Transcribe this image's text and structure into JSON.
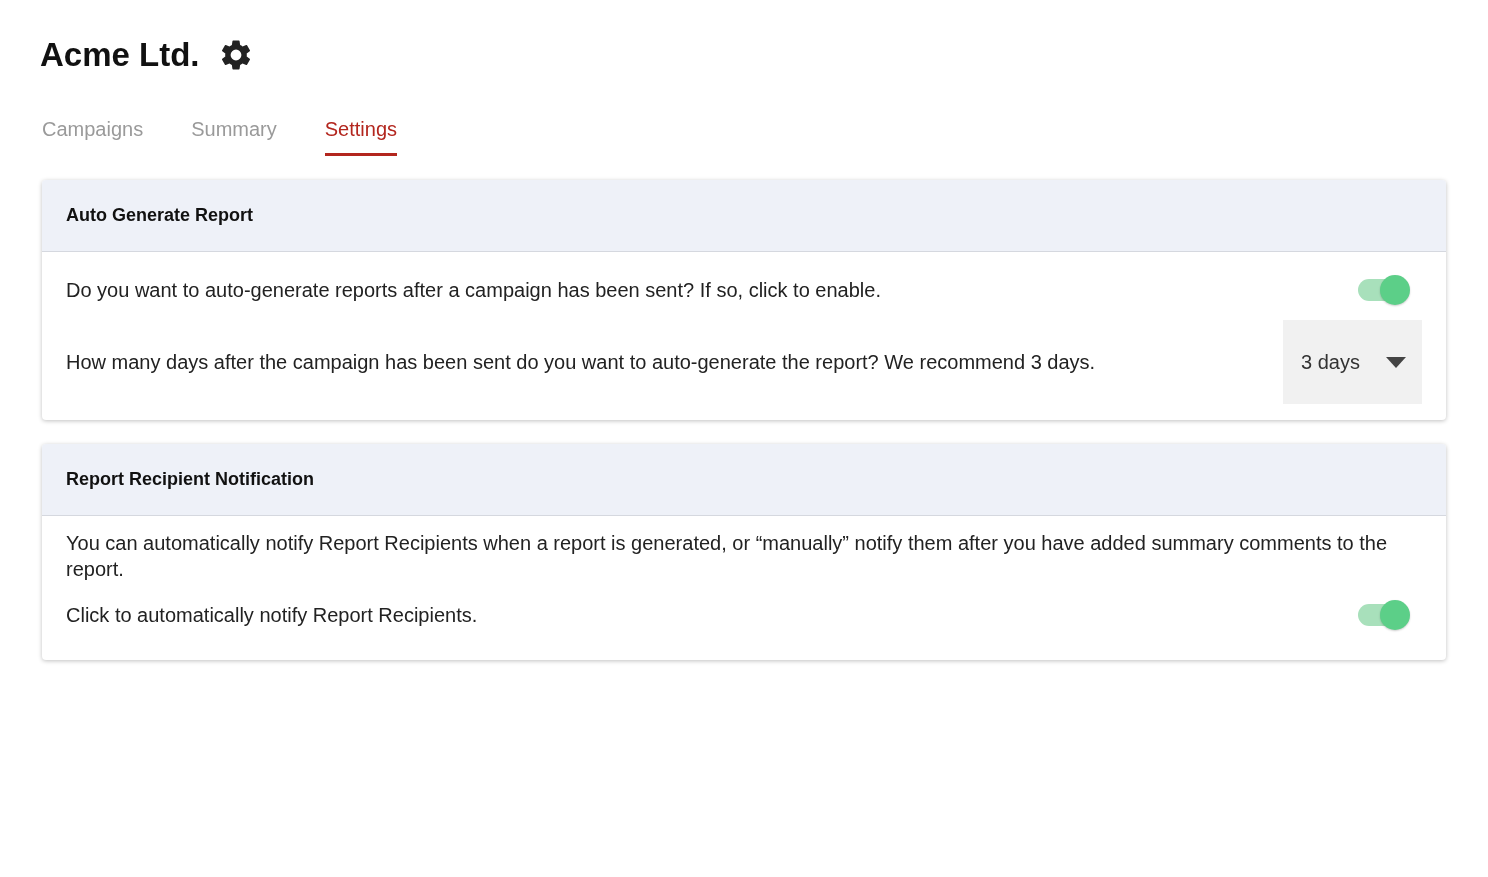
{
  "header": {
    "title": "Acme Ltd."
  },
  "tabs": [
    {
      "label": "Campaigns",
      "selected": false
    },
    {
      "label": "Summary",
      "selected": false
    },
    {
      "label": "Settings",
      "selected": true
    }
  ],
  "sections": [
    {
      "title": "Auto Generate Report",
      "rows": [
        {
          "kind": "toggle",
          "text": "Do you want to auto-generate reports after a campaign has been sent? If so, click to enable.",
          "on": true
        },
        {
          "kind": "select",
          "text": "How many days after the campaign has been sent do you want to auto-generate the report? We recommend 3 days.",
          "value": "3 days"
        }
      ]
    },
    {
      "title": "Report Recipient Notification",
      "rows": [
        {
          "kind": "text",
          "text": "You can automatically notify Report Recipients when a report is generated, or “manually” notify them after you have added summary comments to the report."
        },
        {
          "kind": "toggle",
          "text": "Click to automatically notify Report Recipients.",
          "on": true
        }
      ]
    }
  ]
}
